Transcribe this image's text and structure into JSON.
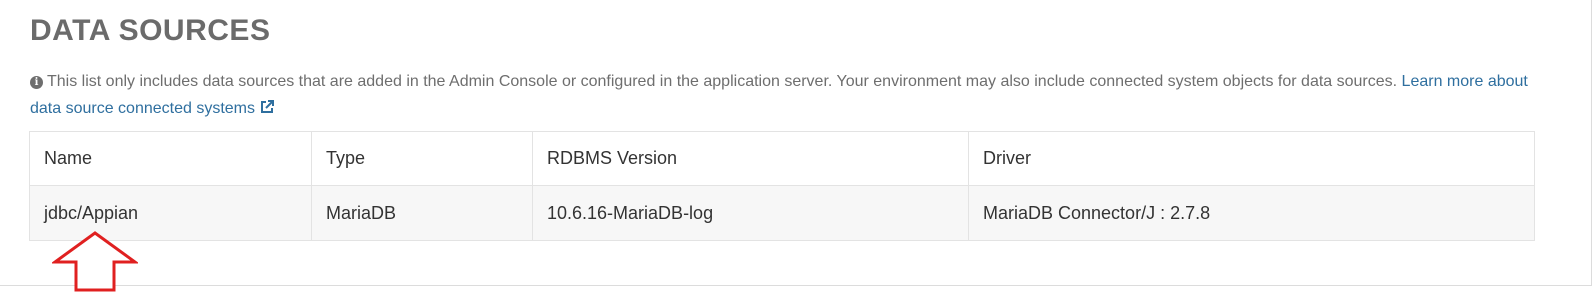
{
  "section": {
    "title": "DATA SOURCES"
  },
  "info": {
    "icon": "info-circle-icon",
    "text": "This list only includes data sources that are added in the Admin Console or configured in the application server. Your environment may also include connected system objects for data sources.",
    "link_text": "Learn more about data source connected systems",
    "link_icon": "external-link-icon"
  },
  "table": {
    "columns": [
      "Name",
      "Type",
      "RDBMS Version",
      "Driver"
    ],
    "rows": [
      {
        "name": "jdbc/Appian",
        "type": "MariaDB",
        "version": "10.6.16-MariaDB-log",
        "driver": "MariaDB Connector/J : 2.7.8"
      }
    ]
  },
  "annotation": {
    "icon": "red-up-arrow-icon",
    "color": "#e02020"
  },
  "colors": {
    "title": "#6b6b6b",
    "link": "#2f6f9f",
    "row_bg": "#f7f7f7",
    "border": "#e3e3e3"
  }
}
